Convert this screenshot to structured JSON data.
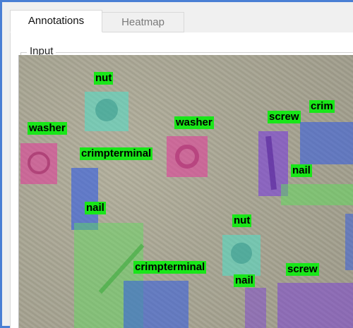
{
  "tabs": [
    {
      "label": "Annotations",
      "active": true
    },
    {
      "label": "Heatmap",
      "active": false
    }
  ],
  "group": {
    "title": "Input"
  },
  "annotations": {
    "nut_1": "nut",
    "washer_1": "washer",
    "crimpterminal_1": "crimpterminal",
    "washer_2": "washer",
    "screw_1": "screw",
    "crimp_partial": "crim",
    "nail_1": "nail",
    "nail_2": "nail",
    "nut_2": "nut",
    "crimpterminal_2": "crimpterminal",
    "nail_3": "nail",
    "screw_2": "screw"
  },
  "colors": {
    "label_bg": "#19e619",
    "frame_border": "#4a7fd4",
    "nut_box": "#4ee0c8",
    "washer_box": "#e0409a",
    "screw_box": "#7a3cdc",
    "nail_box": "#2f5ae6",
    "crimp_box": "#5ee05a"
  }
}
